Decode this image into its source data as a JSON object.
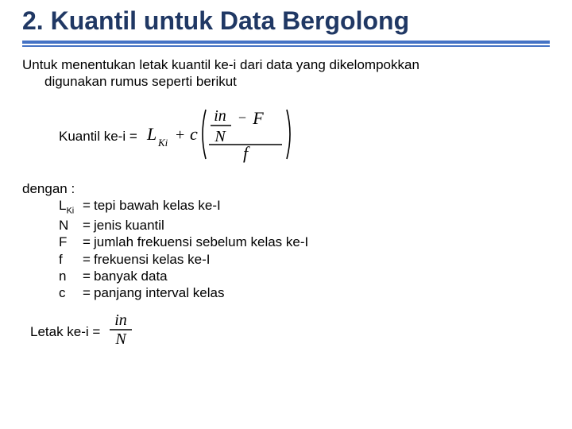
{
  "title": "2. Kuantil untuk Data Bergolong",
  "intro_line1": "Untuk menentukan letak kuantil ke-i dari data yang dikelompokkan",
  "intro_line2": "digunakan rumus seperti berikut",
  "formula_label": "Kuantil ke-i =",
  "formula": {
    "L_sub": "Ki",
    "plus": "+",
    "c": "c",
    "num_left": "in",
    "num_right_minus": "−",
    "num_right_F": "F",
    "over_N": "N",
    "denom": "f"
  },
  "dengan": "dengan :",
  "defs": [
    {
      "sym": "L",
      "sub": "Ki",
      "desc": "tepi bawah kelas ke-I"
    },
    {
      "sym": "N",
      "sub": "",
      "desc": "jenis kuantil"
    },
    {
      "sym": "F",
      "sub": "",
      "desc": "jumlah frekuensi sebelum kelas ke-I"
    },
    {
      "sym": "f",
      "sub": "",
      "desc": "frekuensi kelas ke-I"
    },
    {
      "sym": "n",
      "sub": "",
      "desc": "banyak data"
    },
    {
      "sym": "c",
      "sub": "",
      "desc": "panjang interval kelas"
    }
  ],
  "letak_label": "Letak ke-i =",
  "letak": {
    "num": "in",
    "den": "N"
  }
}
